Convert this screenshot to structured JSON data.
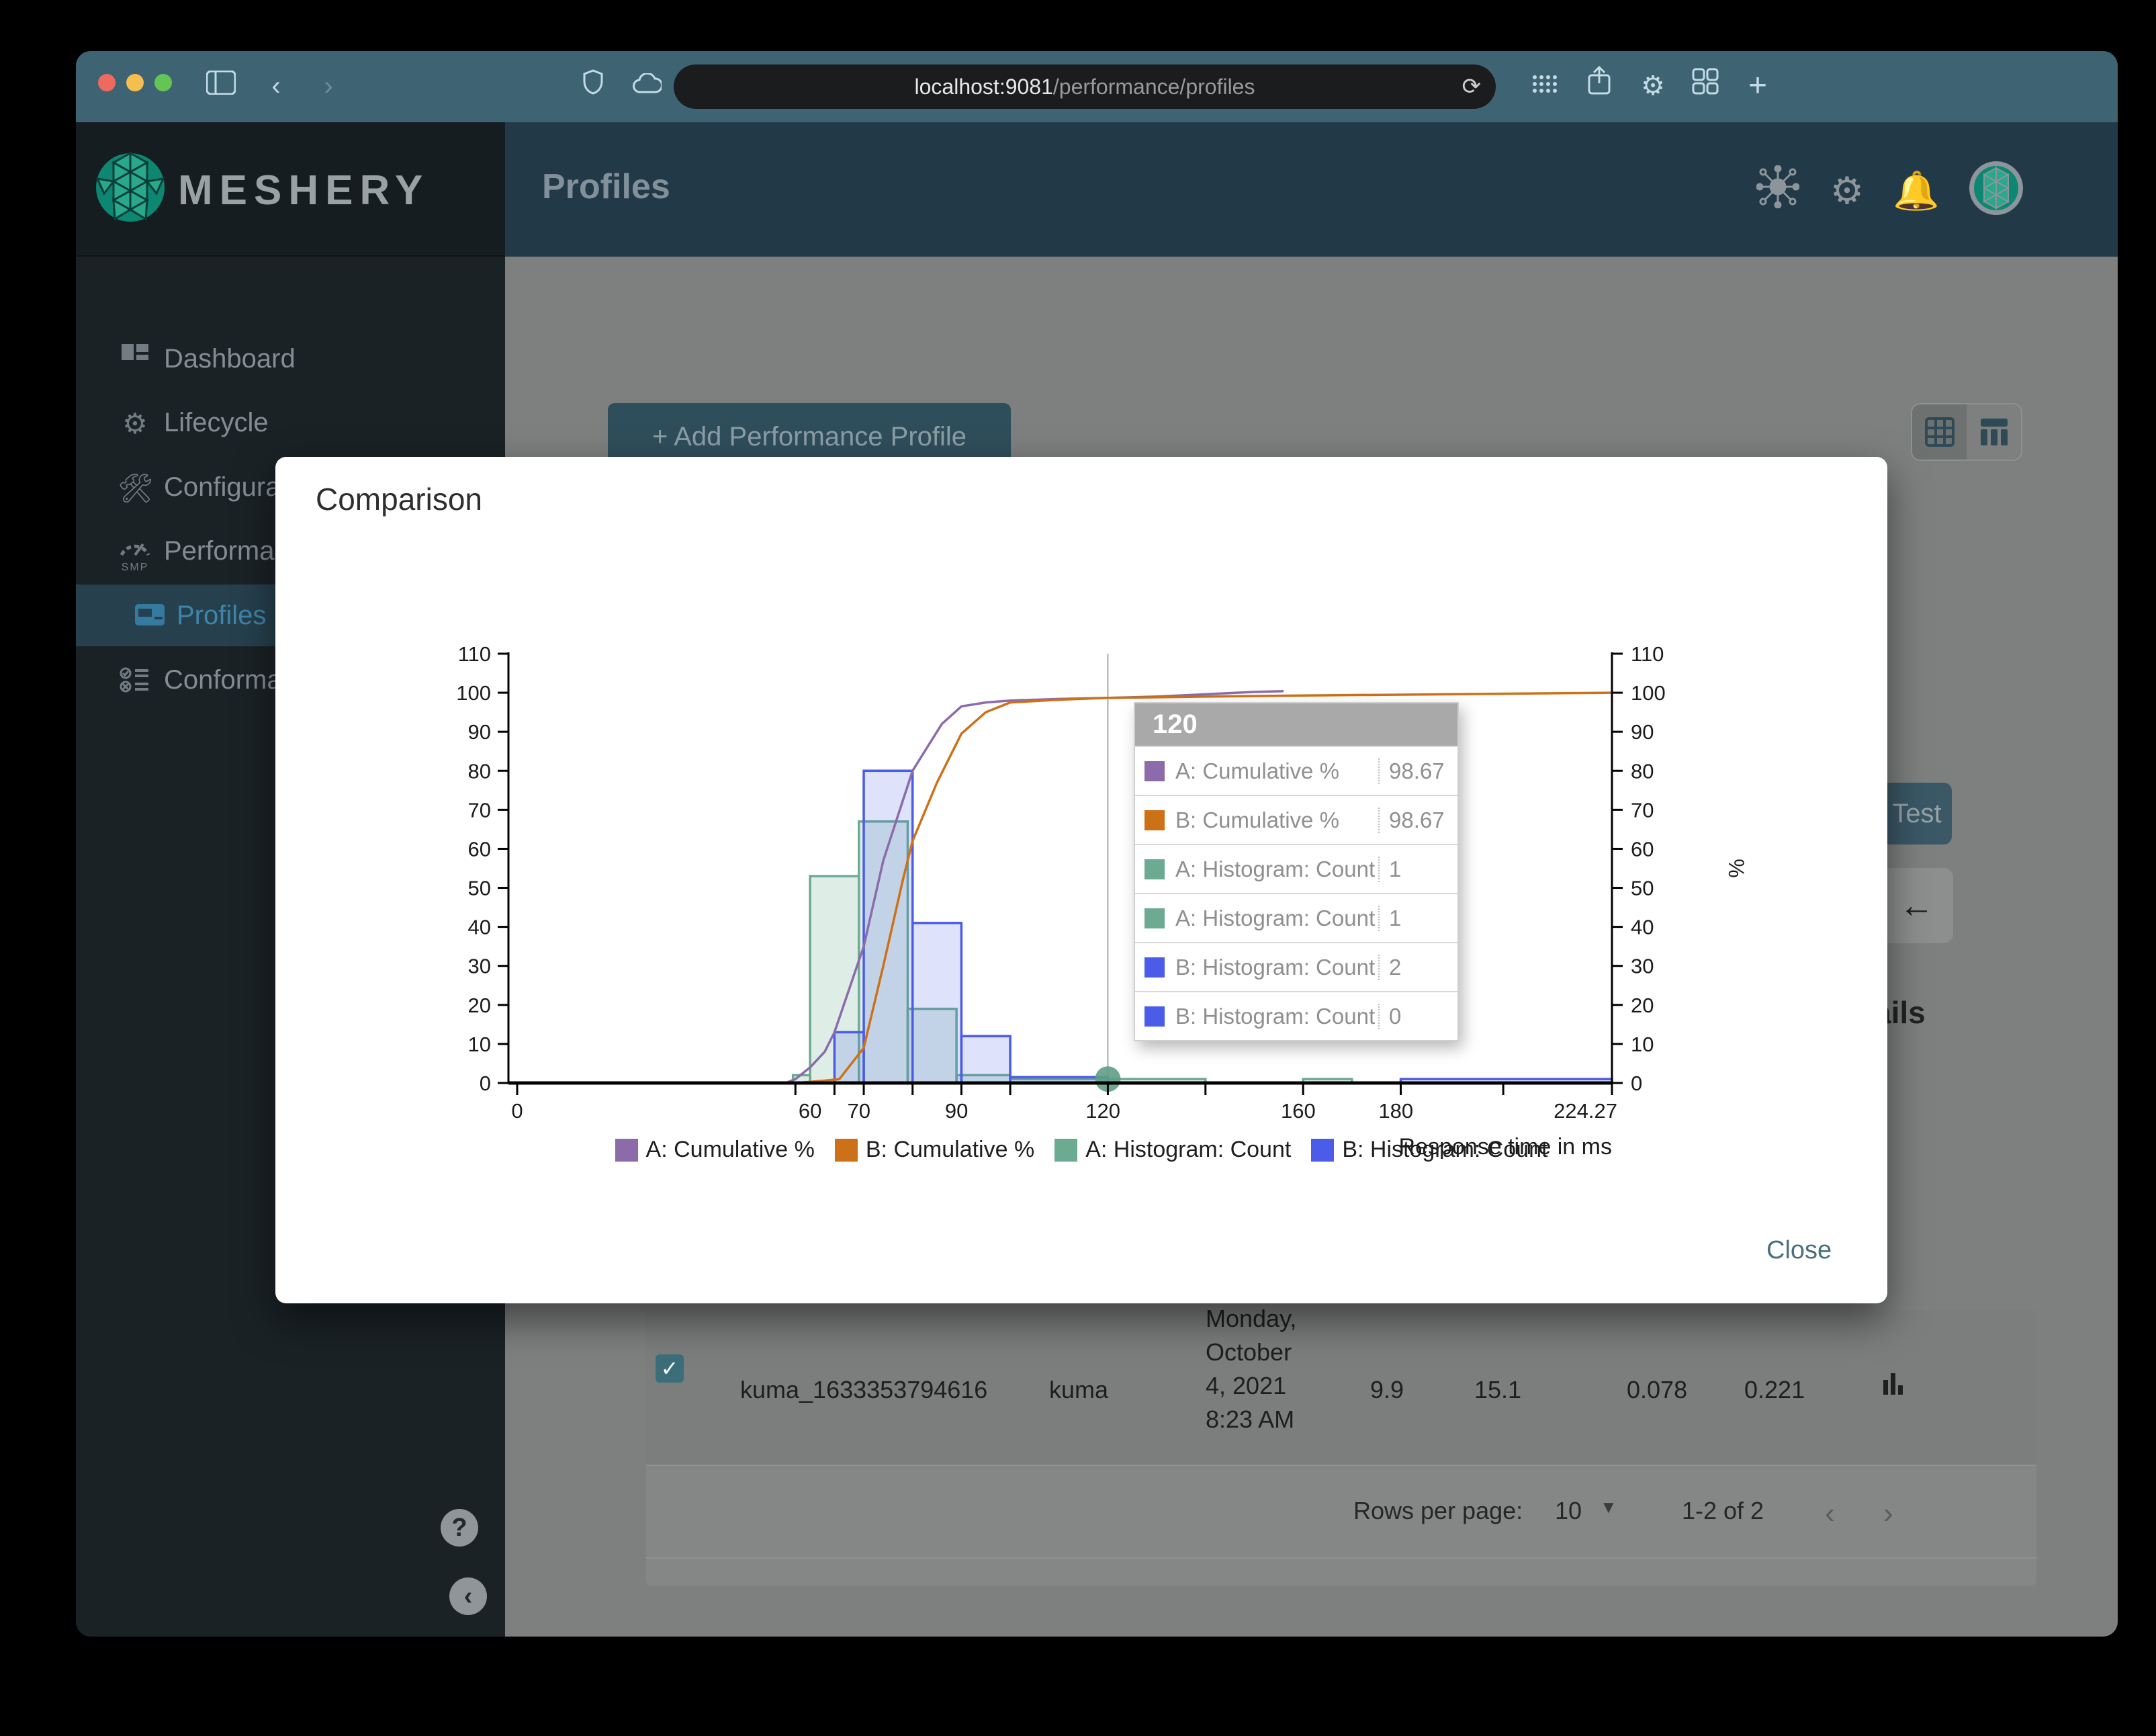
{
  "browser": {
    "url_host": "localhost:9081",
    "url_path": "/performance/profiles",
    "reload_glyph": "⟳",
    "back_glyph": "‹",
    "forward_glyph": "›",
    "new_tab_glyph": "+"
  },
  "sidebar": {
    "brand": "MESHERY",
    "items": [
      {
        "label": "Dashboard"
      },
      {
        "label": "Lifecycle"
      },
      {
        "label": "Configuration"
      },
      {
        "label": "Performance",
        "badge": "SMP"
      },
      {
        "label": "Profiles"
      },
      {
        "label": "Conformance"
      }
    ],
    "help_glyph": "?",
    "collapse_glyph": "‹"
  },
  "appbar": {
    "title": "Profiles"
  },
  "content": {
    "add_button": "+ Add Performance Profile",
    "test_button": "Test",
    "back_arrow": "←",
    "details_partial": "ails"
  },
  "table": {
    "row": {
      "name": "kuma_1633353794616",
      "mesh": "kuma",
      "date_line1": "Monday,",
      "date_line2": "October",
      "date_line3": "4, 2021",
      "date_line4": "8:23 AM",
      "qps": "9.9",
      "duration": "15.1",
      "p50": "0.078",
      "p99": "0.221",
      "check_glyph": "✓"
    },
    "pagination": {
      "rows_label": "Rows per page:",
      "rows_value": "10",
      "range": "1-2 of 2",
      "prev_glyph": "‹",
      "next_glyph": "›"
    }
  },
  "modal": {
    "title": "Comparison",
    "close_label": "Close"
  },
  "chart_data": {
    "type": "bar",
    "subtype": "histogram-with-cumulative-lines",
    "title": "",
    "xlabel": "Response time in ms",
    "ylabel_right": "%",
    "xlim": [
      0,
      224.27
    ],
    "ylim": [
      0,
      110
    ],
    "grid": false,
    "legend_position": "bottom",
    "x_tick_marks": [
      0,
      57,
      65,
      71,
      81,
      91,
      101,
      121,
      141,
      161,
      181,
      202,
      224.27
    ],
    "x_tick_labels": [
      {
        "v": 0,
        "t": "0"
      },
      {
        "v": 60,
        "t": "60"
      },
      {
        "v": 70,
        "t": "70"
      },
      {
        "v": 90,
        "t": "90"
      },
      {
        "v": 120,
        "t": "120"
      },
      {
        "v": 160,
        "t": "160"
      },
      {
        "v": 180,
        "t": "180"
      },
      {
        "v": 224.27,
        "t": "224.27"
      }
    ],
    "y_ticks": [
      0,
      10,
      20,
      30,
      40,
      50,
      60,
      70,
      80,
      90,
      100,
      110
    ],
    "series": [
      {
        "name": "A: Cumulative %",
        "type": "line",
        "color": "#8c6bab",
        "points": [
          [
            55,
            0
          ],
          [
            57,
            1
          ],
          [
            60,
            4
          ],
          [
            63,
            8
          ],
          [
            65,
            13
          ],
          [
            71,
            35
          ],
          [
            75,
            57
          ],
          [
            81,
            80
          ],
          [
            83,
            84
          ],
          [
            87,
            92
          ],
          [
            91,
            96.5
          ],
          [
            96,
            97.5
          ],
          [
            101,
            98
          ],
          [
            111,
            98.4
          ],
          [
            121,
            98.67
          ],
          [
            131,
            99
          ],
          [
            141,
            99.6
          ],
          [
            151,
            100.2
          ],
          [
            157,
            100.4
          ]
        ]
      },
      {
        "name": "B: Cumulative %",
        "type": "line",
        "color": "#cd7118",
        "points": [
          [
            57,
            0
          ],
          [
            63,
            0.6
          ],
          [
            66,
            1
          ],
          [
            71,
            9
          ],
          [
            75,
            30
          ],
          [
            79,
            52
          ],
          [
            81,
            62
          ],
          [
            86,
            77
          ],
          [
            91,
            89.5
          ],
          [
            96,
            95
          ],
          [
            101,
            97.5
          ],
          [
            111,
            98.2
          ],
          [
            121,
            98.67
          ],
          [
            141,
            99
          ],
          [
            161,
            99.3
          ],
          [
            191,
            99.6
          ],
          [
            224.27,
            100
          ]
        ]
      },
      {
        "name": "A: Histogram: Count",
        "type": "bars",
        "color": "#6cab91",
        "fill_opacity": 0.22,
        "bins": [
          [
            56.5,
            60,
            2
          ],
          [
            60,
            70,
            53
          ],
          [
            70,
            80,
            67
          ],
          [
            80,
            90,
            19
          ],
          [
            90,
            101,
            2
          ],
          [
            101,
            121,
            1
          ],
          [
            121,
            141,
            1
          ],
          [
            161,
            171,
            1
          ]
        ]
      },
      {
        "name": "B: Histogram: Count",
        "type": "bars",
        "color": "#4a5ce8",
        "fill_opacity": 0.18,
        "bins": [
          [
            65,
            71,
            13
          ],
          [
            71,
            81,
            80
          ],
          [
            81,
            91,
            41
          ],
          [
            91,
            101,
            12
          ],
          [
            101,
            121,
            1.5
          ],
          [
            181,
            224.27,
            1
          ]
        ]
      }
    ],
    "tooltip": {
      "title": "120",
      "guide_x": 121,
      "marker": {
        "x": 121,
        "y": 1,
        "color": "#5e9f85"
      },
      "rows": [
        {
          "label": "A: Cumulative %",
          "color": "#8c6bab",
          "value": "98.67"
        },
        {
          "label": "B: Cumulative %",
          "color": "#cd7118",
          "value": "98.67"
        },
        {
          "label": "A: Histogram: Count",
          "color": "#6cab91",
          "value": "1"
        },
        {
          "label": "A: Histogram: Count",
          "color": "#6cab91",
          "value": "1"
        },
        {
          "label": "B: Histogram: Count",
          "color": "#4a5ce8",
          "value": "2"
        },
        {
          "label": "B: Histogram: Count",
          "color": "#4a5ce8",
          "value": "0"
        }
      ]
    },
    "legend": [
      {
        "label": "A: Cumulative %",
        "color": "#8c6bab"
      },
      {
        "label": "B: Cumulative %",
        "color": "#cd7118"
      },
      {
        "label": "A: Histogram: Count",
        "color": "#6cab91"
      },
      {
        "label": "B: Histogram: Count",
        "color": "#4a5ce8"
      }
    ]
  }
}
